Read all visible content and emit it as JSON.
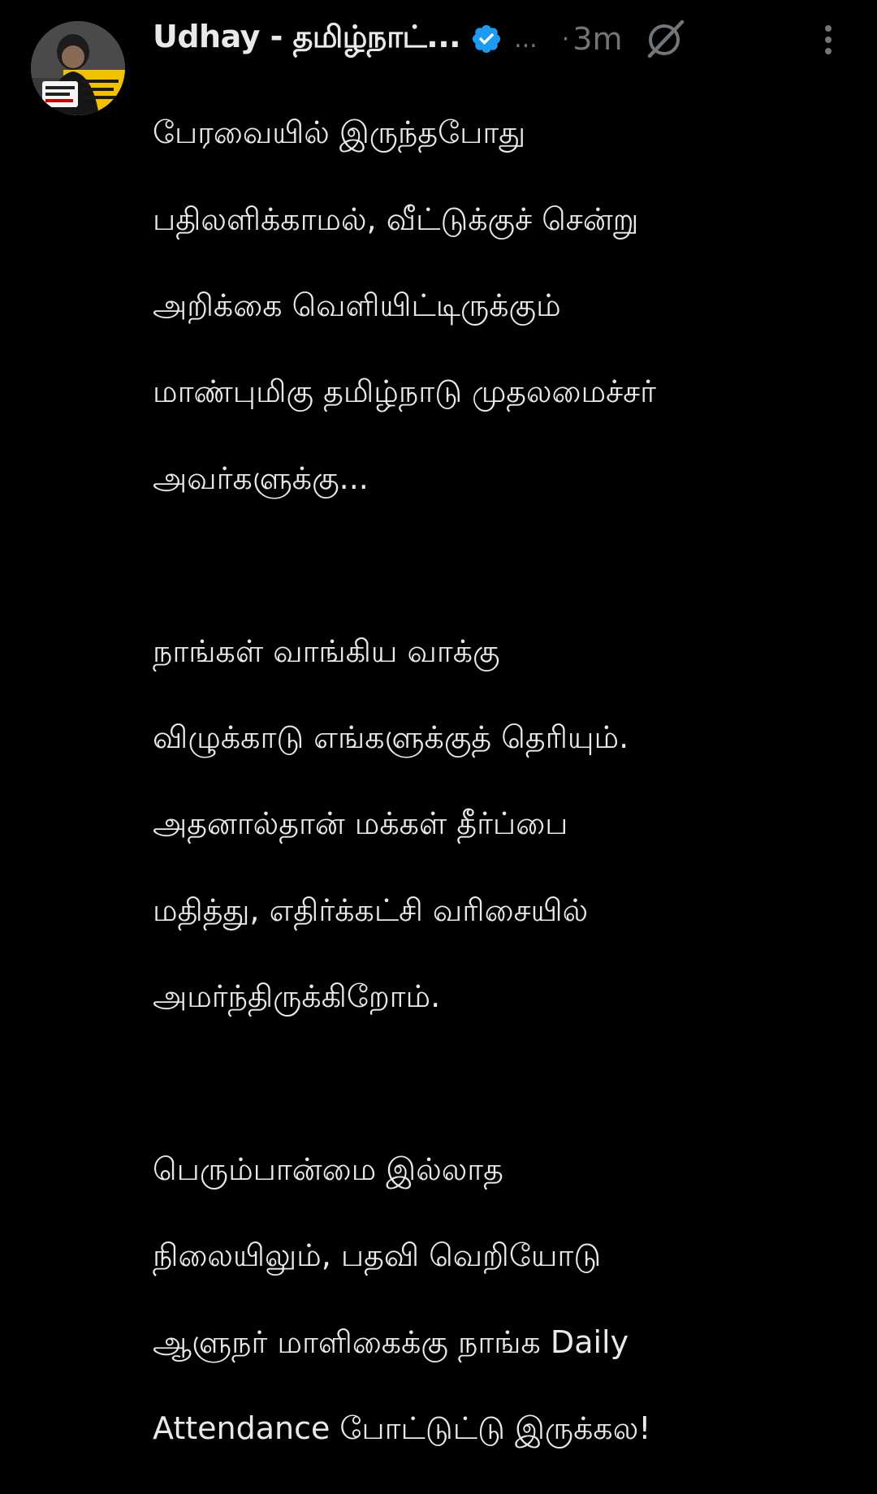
{
  "tweet": {
    "author": {
      "display_name": "Udhay - தமிழ்நாட்...",
      "verified_icon": "verified-badge-icon",
      "handle_truncated": "..."
    },
    "separator": "·",
    "timestamp": "3m",
    "icons": {
      "grok": "grok-icon",
      "more": "more-vertical-icon"
    },
    "paragraphs": [
      {
        "lines": [
          "பேரவையில் இருந்தபோது",
          "பதிலளிக்காமல், வீட்டுக்குச் சென்று",
          "அறிக்கை வெளியிட்டிருக்கும்",
          "மாண்புமிகு தமிழ்நாடு முதலமைச்சர்",
          "அவர்களுக்கு..."
        ]
      },
      {
        "lines": [
          "நாங்கள் வாங்கிய வாக்கு",
          "விழுக்காடு எங்களுக்குத் தெரியும்.",
          "அதனால்தான் மக்கள் தீர்ப்பை",
          "மதித்து, எதிர்க்கட்சி வரிசையில்",
          "அமர்ந்திருக்கிறோம்."
        ]
      },
      {
        "lines": [
          "பெரும்பான்மை இல்லாத",
          "நிலையிலும், பதவி வெறியோடு",
          "ஆளுநர் மாளிகைக்கு நாங்க Daily",
          "Attendance போட்டுட்டு இருக்கல!"
        ]
      }
    ]
  },
  "colors": {
    "background": "#000000",
    "text_primary": "#e7e9ea",
    "text_secondary": "#71767b",
    "verified_blue": "#1d9bf0"
  }
}
